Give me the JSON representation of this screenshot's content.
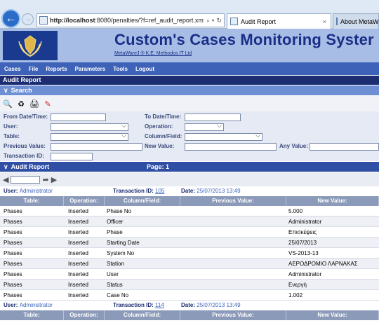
{
  "browser": {
    "url_host": "http://localhost",
    "url_rest": ":8080/penalties/?f=ref_audit_report.xm",
    "addr_tools": [
      "⌕ ▾",
      "↻"
    ],
    "tabs": [
      {
        "label": "Audit Report",
        "close": "×"
      },
      {
        "label": "About MetaW"
      }
    ]
  },
  "banner": {
    "title": "Custom's Cases Monitoring Syster",
    "subtitle": "MetaWareJ ® K.E. Methodos IT Ltd"
  },
  "menu": [
    "Cases",
    "File",
    "Reports",
    "Parameters",
    "Tools",
    "Logout"
  ],
  "page_title": "Audit Report",
  "search_section": {
    "label": "Search"
  },
  "filters": {
    "from_label": "From Date/Time:",
    "to_label": "To Date/Time:",
    "user_label": "User:",
    "operation_label": "Operation:",
    "table_label": "Table:",
    "column_label": "Column/Field:",
    "prev_label": "Previous Value:",
    "new_label": "New Value:",
    "any_label": "Any Value:",
    "tx_label": "Transaction ID:"
  },
  "audit_section": {
    "label": "Audit Report",
    "page": "Page: 1"
  },
  "pager": {
    "prev": "◀",
    "next": "▶"
  },
  "labels": {
    "user": "User:",
    "transaction": "Transaction ID:",
    "date": "Date:"
  },
  "columns": [
    "Table:",
    "Operation:",
    "Column/Field:",
    "Previous Value:",
    "New Value:"
  ],
  "groups": [
    {
      "user": "Administrator",
      "transaction_id": "105",
      "date": "25/07/2013 13:49",
      "rows": [
        {
          "table": "Phases",
          "operation": "Inserted",
          "column": "Phase No",
          "previous": "",
          "new": "5.000"
        },
        {
          "table": "Phases",
          "operation": "Inserted",
          "column": "Officer",
          "previous": "",
          "new": "Administrator"
        },
        {
          "table": "Phases",
          "operation": "Inserted",
          "column": "Phase",
          "previous": "",
          "new": "Επισκέψεις"
        },
        {
          "table": "Phases",
          "operation": "Inserted",
          "column": "Starting Date",
          "previous": "",
          "new": "25/07/2013"
        },
        {
          "table": "Phases",
          "operation": "Inserted",
          "column": "System No",
          "previous": "",
          "new": "VS-2013-13"
        },
        {
          "table": "Phases",
          "operation": "Inserted",
          "column": "Station",
          "previous": "",
          "new": "ΑΕΡΟΔΡΟΜΙΟ ΛΑΡΝΑΚΑΣ"
        },
        {
          "table": "Phases",
          "operation": "Inserted",
          "column": "User",
          "previous": "",
          "new": "Administrator"
        },
        {
          "table": "Phases",
          "operation": "Inserted",
          "column": "Status",
          "previous": "",
          "new": "Ενεργή"
        },
        {
          "table": "Phases",
          "operation": "Inserted",
          "column": "Case No",
          "previous": "",
          "new": "1.002"
        }
      ]
    },
    {
      "user": "Administrator",
      "transaction_id": "114",
      "date": "25/07/2013 13:49",
      "rows": []
    }
  ]
}
